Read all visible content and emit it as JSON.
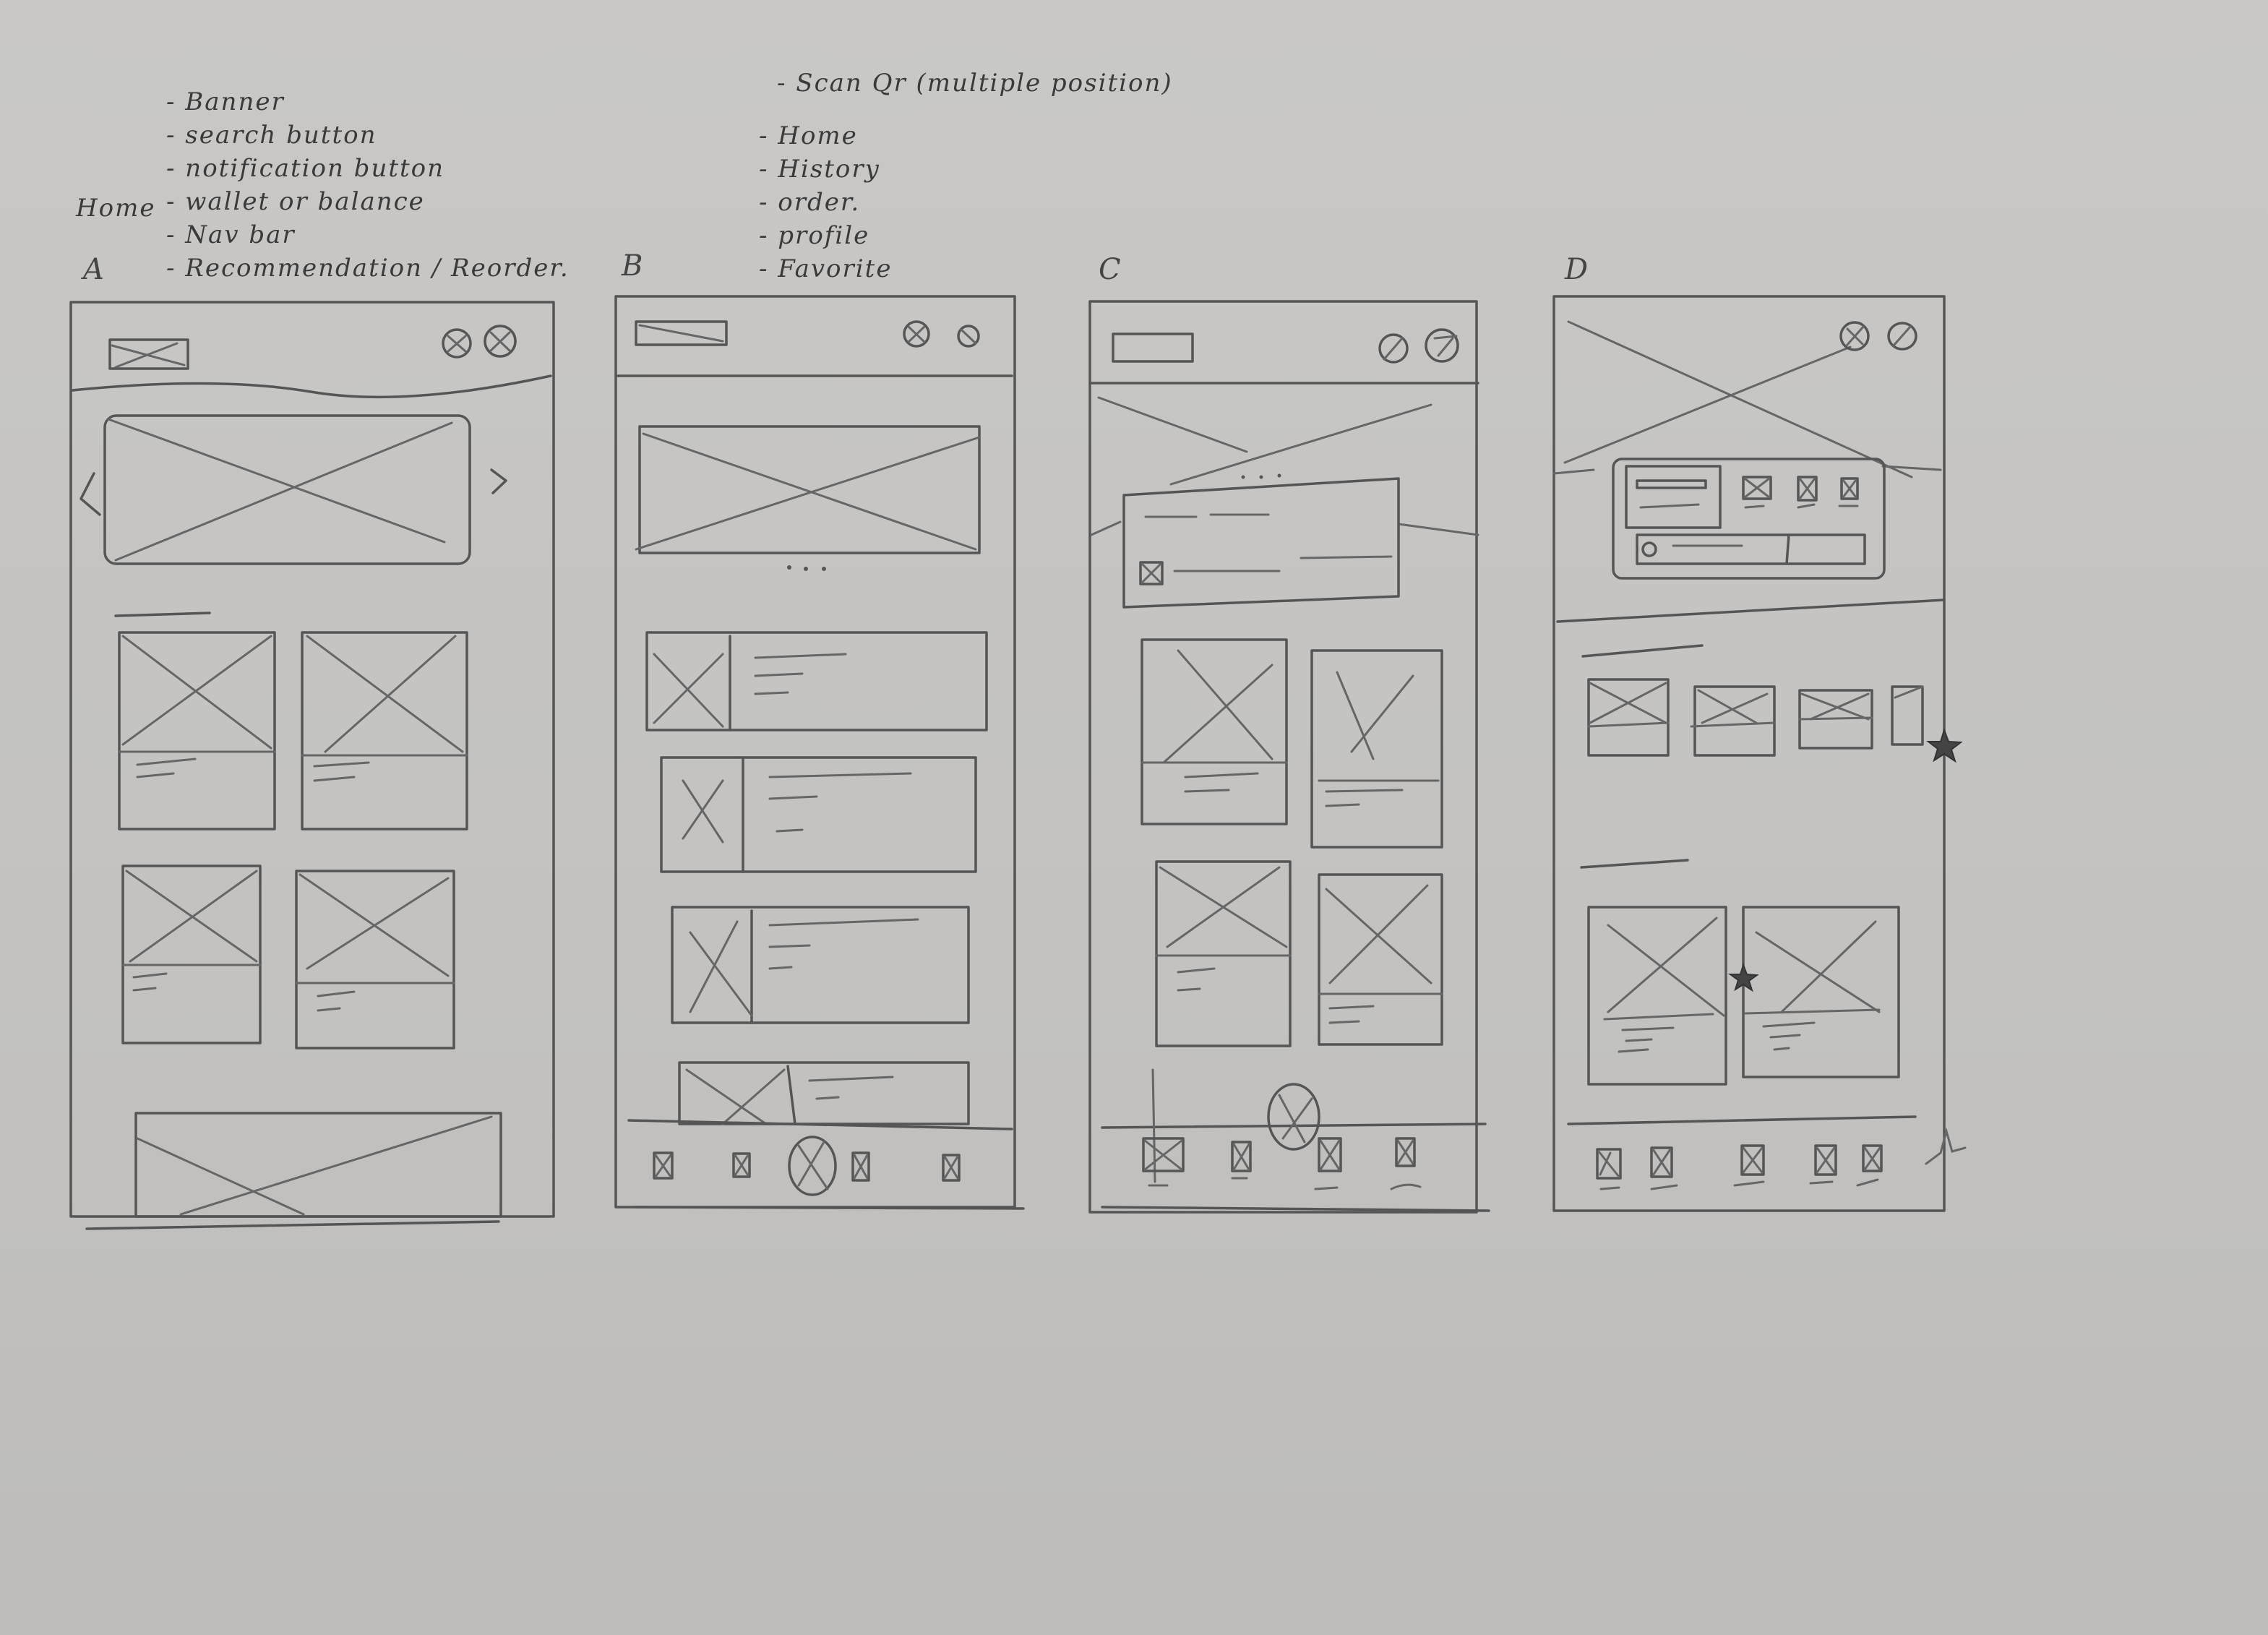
{
  "home_notes": {
    "heading": "Home",
    "items": [
      "Banner",
      "search button",
      "notification button",
      "wallet or balance",
      "Nav bar",
      "Recommendation / Reorder."
    ]
  },
  "navbar_notes": {
    "lead": "Scan Qr (multiple position)",
    "items": [
      "Home",
      "History",
      "order.",
      "profile",
      "Favorite"
    ]
  },
  "sketches": [
    {
      "label": "A",
      "sections": [
        "header-logo",
        "search-icon",
        "notification-icon",
        "banner-carousel",
        "product-grid-2x2",
        "bottom-banner"
      ]
    },
    {
      "label": "B",
      "sections": [
        "header-logo",
        "search-icon",
        "notification-icon",
        "banner-carousel",
        "list-items",
        "bottom-nav-center-scan"
      ]
    },
    {
      "label": "C",
      "sections": [
        "header-logo",
        "search-icon",
        "notification-icon",
        "hero-banner",
        "wallet-card",
        "product-grid-2x2",
        "bottom-nav-floating-scan"
      ]
    },
    {
      "label": "D",
      "sections": [
        "hero-banner-with-icons",
        "wallet-card-with-shortcuts",
        "favorites-row",
        "recommendation-grid",
        "bottom-nav"
      ]
    }
  ]
}
